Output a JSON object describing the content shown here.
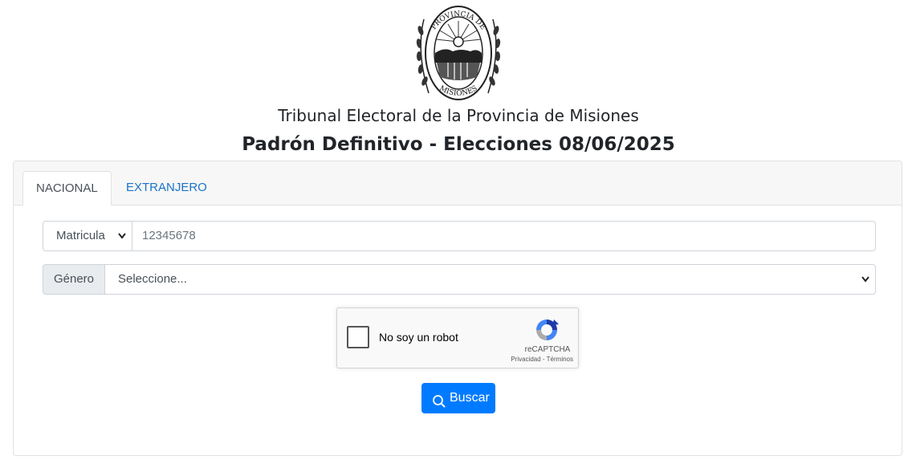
{
  "header": {
    "seal": {
      "alt_text_top": "PROVINCIA DE",
      "alt_text_bottom": "MISIONES"
    },
    "title": "Tribunal Electoral de la Provincia de Misiones",
    "subtitle": "Padrón Definitivo - Elecciones 08/06/2025"
  },
  "tabs": [
    {
      "label": "NACIONAL",
      "active": true
    },
    {
      "label": "EXTRANJERO",
      "active": false
    }
  ],
  "form": {
    "doc_type": {
      "selected": "Matricula"
    },
    "doc_number": {
      "value": "12345678"
    },
    "gender": {
      "addon_label": "Género",
      "selected": "Seleccione..."
    }
  },
  "captcha": {
    "label": "No soy un robot",
    "brand": "reCAPTCHA",
    "links": "Privacidad - Términos"
  },
  "search_button": {
    "label": "Buscar"
  },
  "colors": {
    "primary": "#007bff",
    "link": "#1a73c8",
    "border": "#dee2e6"
  },
  "icons": {
    "search": "search-icon",
    "chevron": "chevron-down-icon",
    "captcha_logo": "recaptcha-icon"
  }
}
